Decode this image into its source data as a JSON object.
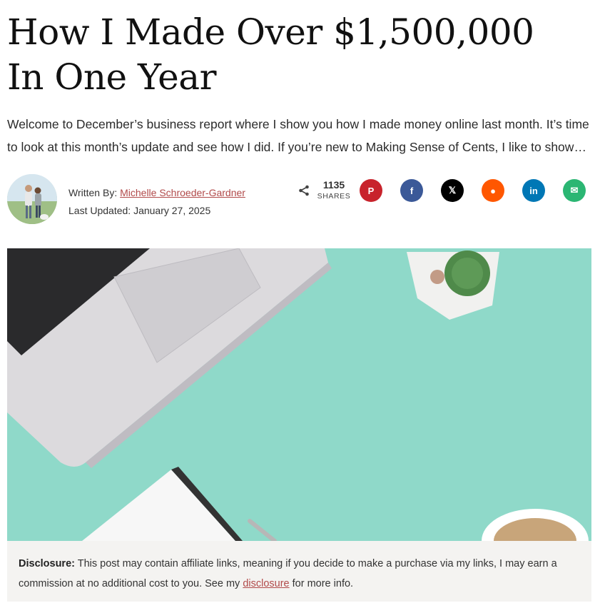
{
  "article": {
    "title": "How I Made Over $1,500,000 In One Year",
    "excerpt": "Welcome to December’s business report where I show you how I made money online last month. It’s time to look at this month’s update and see how I did. If you’re new to Making Sense of Cents, I like to show you how I made money online last month."
  },
  "author": {
    "written_by_label": "Written By:",
    "name": "Michelle Schroeder-Gardner",
    "updated_label": "Last Updated:",
    "updated_date": "January 27, 2025",
    "avatar_alt": "Michelle Schroeder-Gardner"
  },
  "share": {
    "count": "1135",
    "label": "SHARES",
    "buttons": [
      {
        "network": "pinterest",
        "glyph": "P",
        "color": "#c8232c"
      },
      {
        "network": "facebook",
        "glyph": "f",
        "color": "#3b5998"
      },
      {
        "network": "x",
        "glyph": "𝕏",
        "color": "#000000"
      },
      {
        "network": "reddit",
        "glyph": "●",
        "color": "#ff5700"
      },
      {
        "network": "linkedin",
        "glyph": "in",
        "color": "#0077b5"
      },
      {
        "network": "email",
        "glyph": "✉",
        "color": "#2bb673"
      }
    ]
  },
  "hero": {
    "alt": "Laptop, cactus, notebook and coffee on a mint desk",
    "bg_color": "#8fd9c9"
  },
  "disclosure": {
    "label": "Disclosure:",
    "text_before": " This post may contain affiliate links, meaning if you decide to make a purchase via my links, I may earn a commission at no additional cost to you. See my ",
    "link_text": "disclosure",
    "text_after": " for more info."
  }
}
